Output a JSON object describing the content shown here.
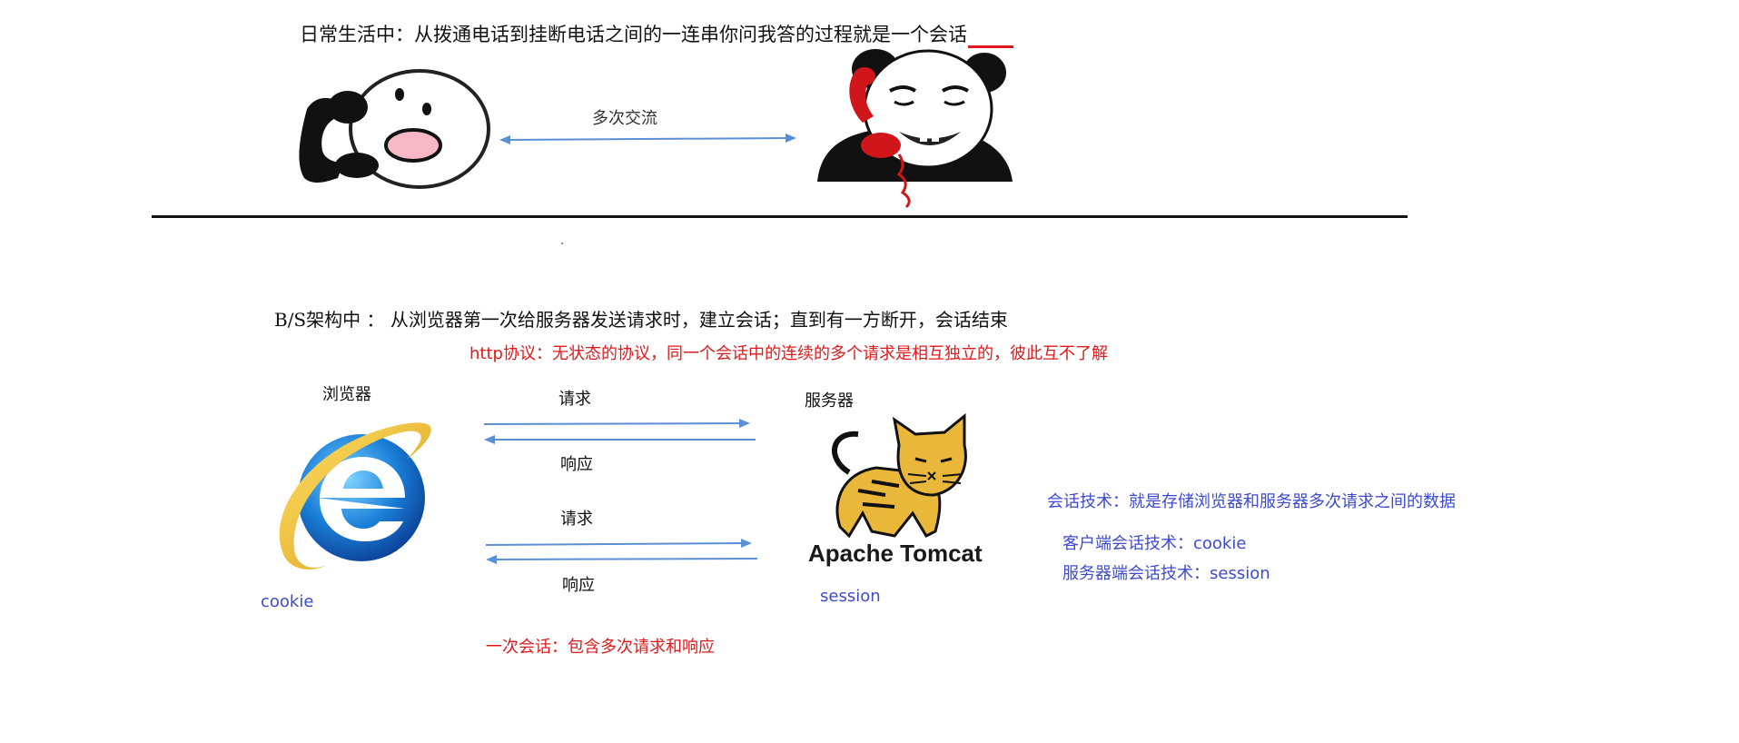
{
  "top": {
    "sentence": "日常生活中：从拨通电话到挂断电话之间的一连串你问我答的过程就是一个会话",
    "exchange_label": "多次交流"
  },
  "bs": {
    "sentence": "B/S架构中 ： 从浏览器第一次给服务器发送请求时，建立会话；直到有一方断开，会话结束",
    "http_note": "http协议：无状态的协议，同一个会话中的连续的多个请求是相互独立的，彼此互不了解",
    "browser_label": "浏览器",
    "server_label": "服务器",
    "request_1": "请求",
    "response_1": "响应",
    "request_2": "请求",
    "response_2": "响应",
    "cookie_label": "cookie",
    "session_label": "session",
    "one_session_note": "一次会话：包含多次请求和响应",
    "tomcat_wordmark": "Apache Tomcat"
  },
  "tech": {
    "definition": "会话技术：就是存储浏览器和服务器多次请求之间的数据",
    "client": "客户端会话技术：cookie",
    "server": "服务器端会话技术：session"
  },
  "icons": {
    "caller_left": "cartoon-caller-icon",
    "caller_right": "panda-phone-icon",
    "browser": "internet-explorer-icon",
    "server": "tomcat-cat-icon"
  },
  "colors": {
    "accent_red": "#e0191b",
    "text_blue": "#3d4ad0",
    "arrow_blue": "#5b8fd6"
  }
}
